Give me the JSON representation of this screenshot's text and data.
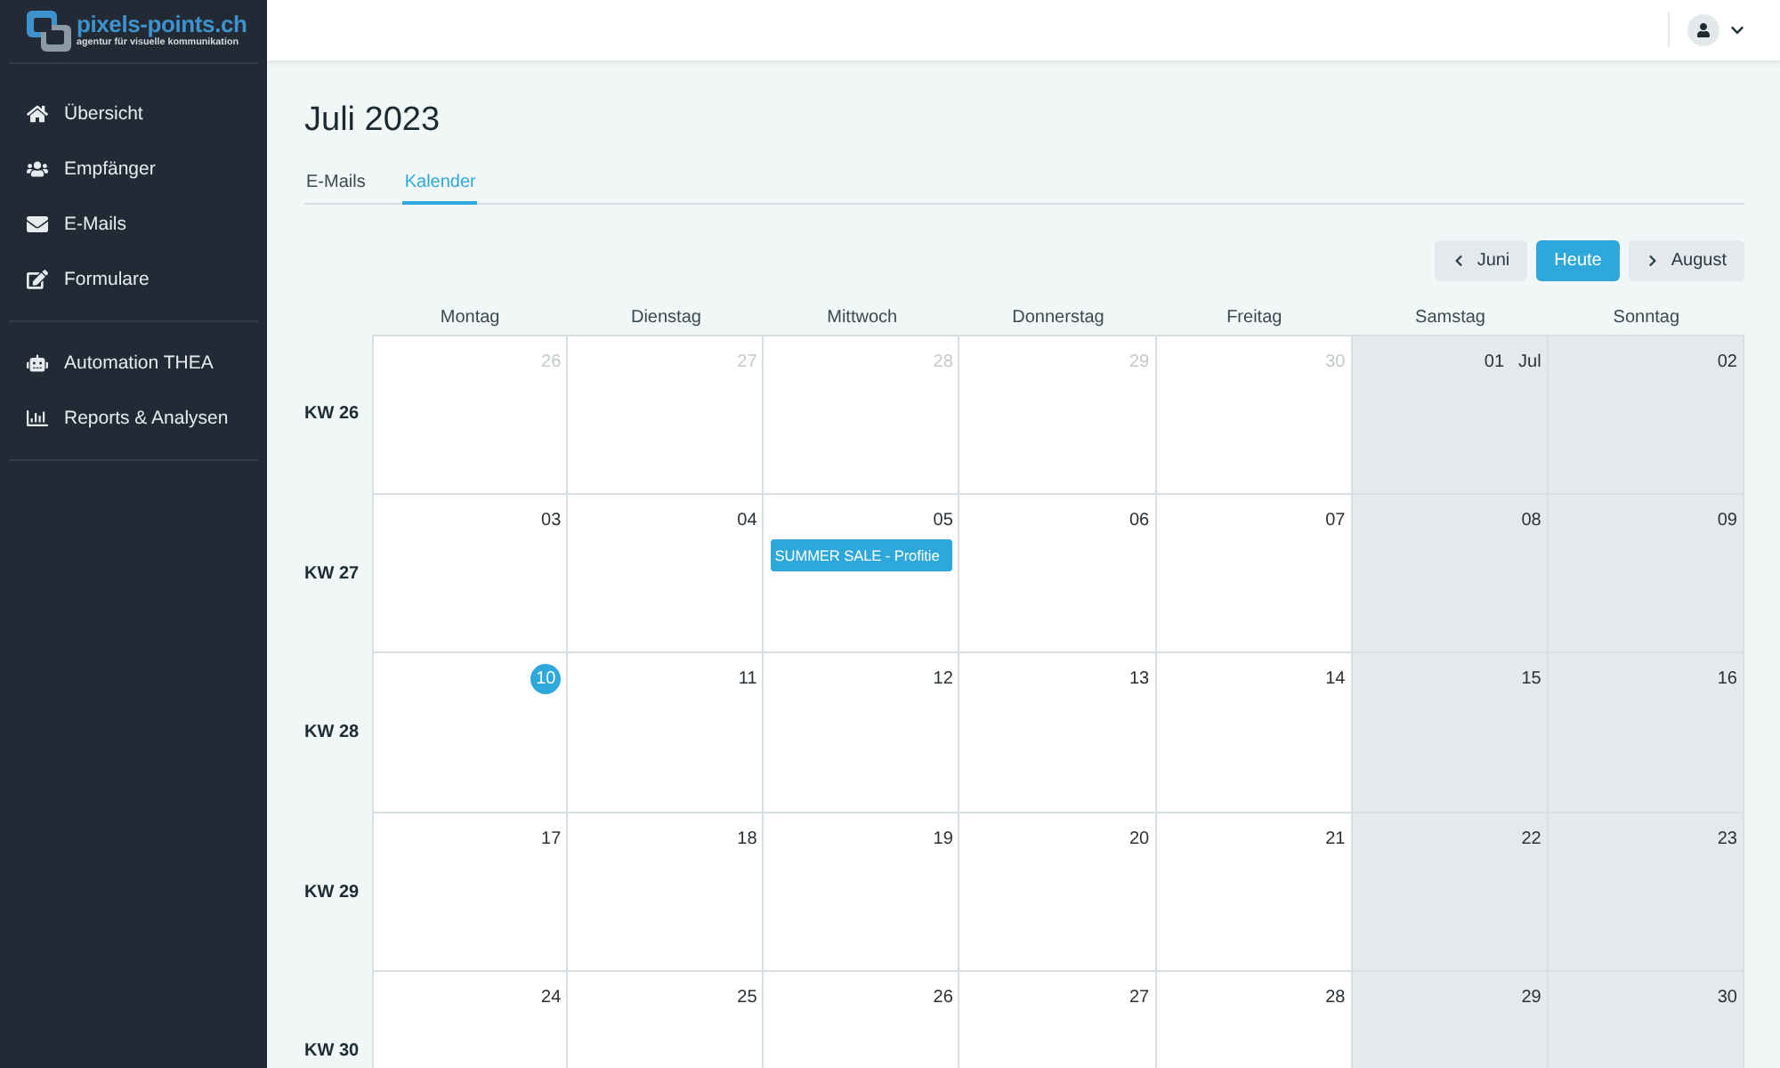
{
  "sidebar": {
    "logo": {
      "name": "pixels-points.ch",
      "tagline": "agentur für visuelle kommunikation"
    },
    "groups": [
      {
        "items": [
          {
            "label": "Übersicht",
            "selected": false
          },
          {
            "label": "Empfänger",
            "selected": false
          },
          {
            "label": "E-Mails",
            "selected": false
          },
          {
            "label": "Formulare",
            "selected": false
          }
        ]
      },
      {
        "items": [
          {
            "label": "Automation THEA",
            "selected": false
          },
          {
            "label": "Reports & Analysen",
            "selected": false
          }
        ]
      }
    ]
  },
  "page": {
    "title": "Juli 2023",
    "tabs": [
      {
        "label": "E-Mails",
        "selected": false
      },
      {
        "label": "Kalender",
        "selected": true
      }
    ]
  },
  "calendar": {
    "nav": [
      {
        "kind": "prev",
        "label": "Juni"
      },
      {
        "kind": "today",
        "label": "Heute"
      },
      {
        "kind": "next",
        "label": "August"
      }
    ],
    "weekdays": [
      {
        "label": "Montag",
        "weekend": false
      },
      {
        "label": "Dienstag",
        "weekend": false
      },
      {
        "label": "Mittwoch",
        "weekend": false
      },
      {
        "label": "Donnerstag",
        "weekend": false
      },
      {
        "label": "Freitag",
        "weekend": false
      },
      {
        "label": "Samstag",
        "weekend": true
      },
      {
        "label": "Sonntag",
        "weekend": true
      }
    ],
    "weeks": [
      {
        "label": "KW 26",
        "days": [
          {
            "date": "26",
            "outside": true,
            "today": false
          },
          {
            "date": "27",
            "outside": true,
            "today": false
          },
          {
            "date": "28",
            "outside": true,
            "today": false
          },
          {
            "date": "29",
            "outside": true,
            "today": false
          },
          {
            "date": "30",
            "outside": true,
            "today": false
          },
          {
            "date": "01",
            "month": "Jul",
            "outside": false,
            "today": false
          },
          {
            "date": "02",
            "outside": false,
            "today": false
          }
        ]
      },
      {
        "label": "KW 27",
        "days": [
          {
            "date": "03",
            "outside": false,
            "today": false
          },
          {
            "date": "04",
            "outside": false,
            "today": false
          },
          {
            "date": "05",
            "outside": false,
            "today": false,
            "events": [
              {
                "title": "SUMMER SALE - Profitie"
              }
            ]
          },
          {
            "date": "06",
            "outside": false,
            "today": false
          },
          {
            "date": "07",
            "outside": false,
            "today": false
          },
          {
            "date": "08",
            "outside": false,
            "today": false
          },
          {
            "date": "09",
            "outside": false,
            "today": false
          }
        ]
      },
      {
        "label": "KW 28",
        "days": [
          {
            "date": "10",
            "outside": false,
            "today": true
          },
          {
            "date": "11",
            "outside": false,
            "today": false
          },
          {
            "date": "12",
            "outside": false,
            "today": false
          },
          {
            "date": "13",
            "outside": false,
            "today": false
          },
          {
            "date": "14",
            "outside": false,
            "today": false
          },
          {
            "date": "15",
            "outside": false,
            "today": false
          },
          {
            "date": "16",
            "outside": false,
            "today": false
          }
        ]
      },
      {
        "label": "KW 29",
        "days": [
          {
            "date": "17",
            "outside": false,
            "today": false
          },
          {
            "date": "18",
            "outside": false,
            "today": false
          },
          {
            "date": "19",
            "outside": false,
            "today": false
          },
          {
            "date": "20",
            "outside": false,
            "today": false
          },
          {
            "date": "21",
            "outside": false,
            "today": false
          },
          {
            "date": "22",
            "outside": false,
            "today": false
          },
          {
            "date": "23",
            "outside": false,
            "today": false
          }
        ]
      },
      {
        "label": "KW 30",
        "days": [
          {
            "date": "24",
            "outside": false,
            "today": false
          },
          {
            "date": "25",
            "outside": false,
            "today": false
          },
          {
            "date": "26",
            "outside": false,
            "today": false
          },
          {
            "date": "27",
            "outside": false,
            "today": false
          },
          {
            "date": "28",
            "outside": false,
            "today": false
          },
          {
            "date": "29",
            "outside": false,
            "today": false
          },
          {
            "date": "30",
            "outside": false,
            "today": false
          }
        ]
      }
    ]
  }
}
